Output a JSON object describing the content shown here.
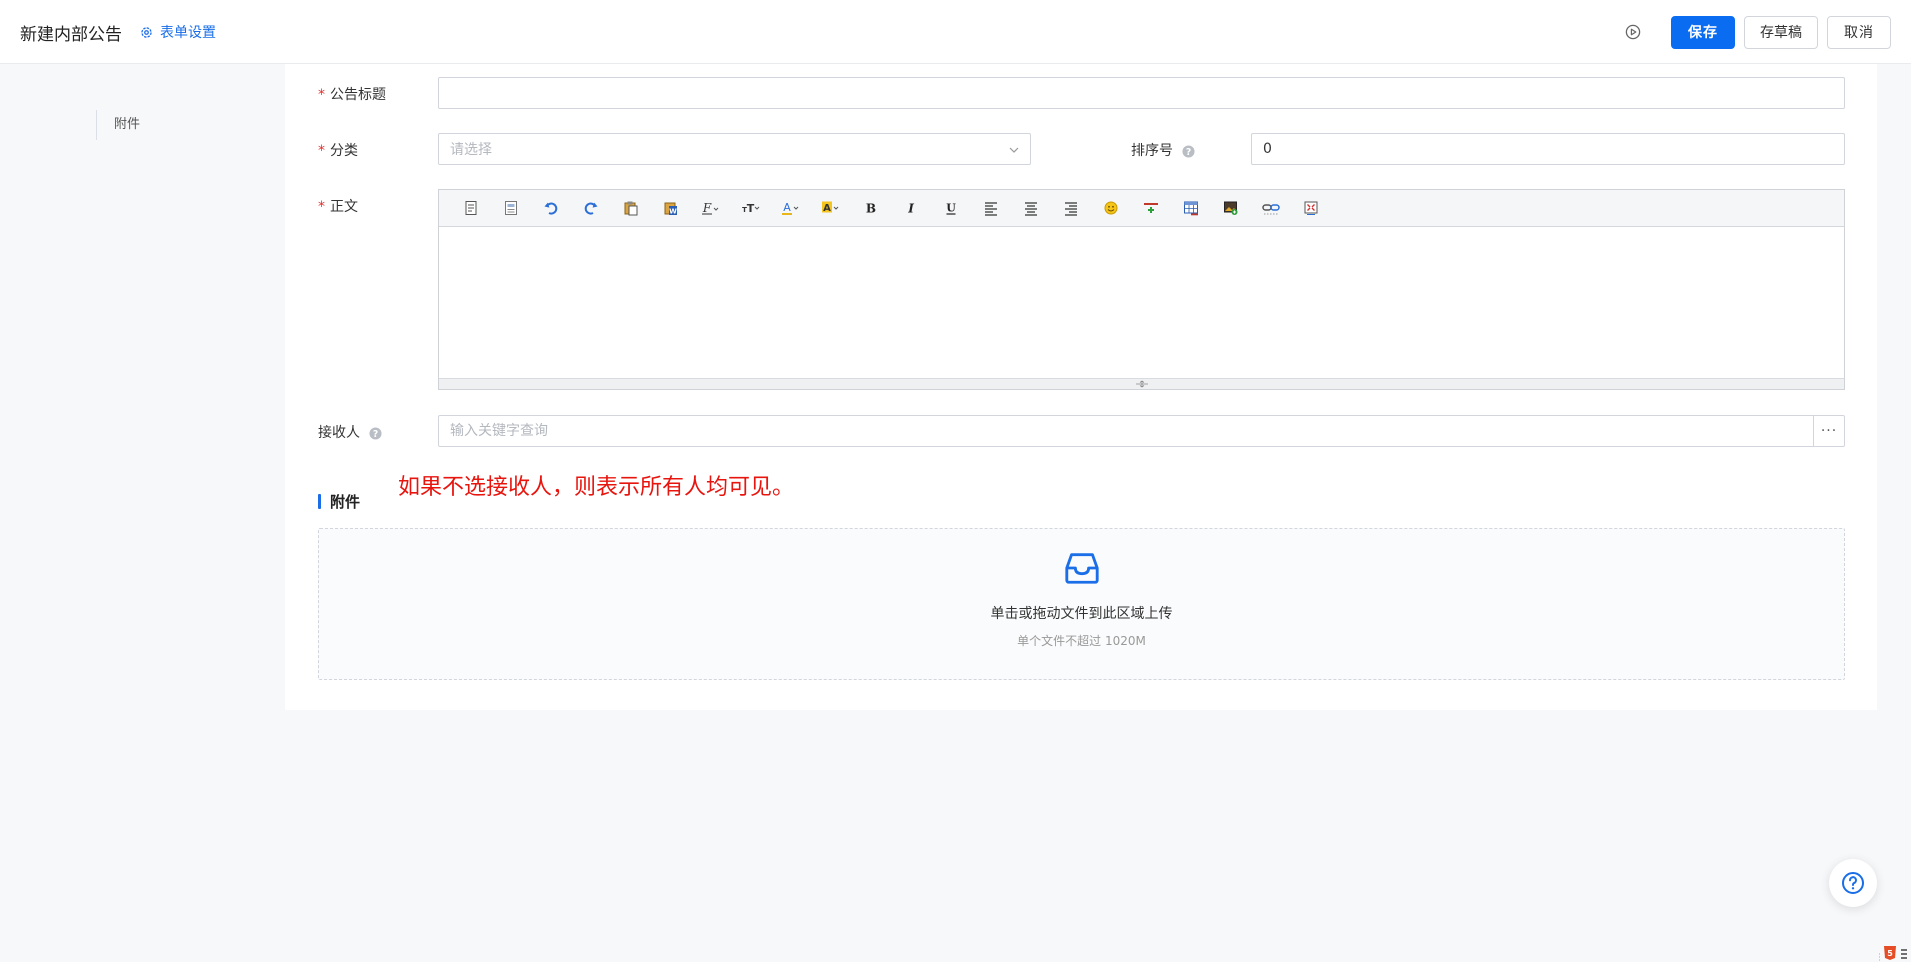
{
  "header": {
    "title": "新建内部公告",
    "form_settings": "表单设置",
    "save": "保存",
    "draft": "存草稿",
    "cancel": "取消"
  },
  "side_anchor": {
    "label": "附件"
  },
  "form": {
    "title_label": "公告标题",
    "title_value": "",
    "category_label": "分类",
    "category_placeholder": "请选择",
    "sort_label": "排序号",
    "sort_value": "0",
    "body_label": "正文",
    "receiver_label": "接收人",
    "receiver_placeholder": "输入关键字查询",
    "more": "···"
  },
  "note": "如果不选接收人，则表示所有人均可见。",
  "attachment": {
    "section_title": "附件",
    "upload_title": "单击或拖动文件到此区域上传",
    "upload_hint": "单个文件不超过 1020M"
  },
  "toolbar_icons": [
    "source-icon",
    "template-icon",
    "undo-icon",
    "redo-icon",
    "paste-icon",
    "paste-word-icon",
    "font-family-icon",
    "font-size-icon",
    "font-color-icon",
    "background-color-icon",
    "bold-icon",
    "italic-icon",
    "underline-icon",
    "align-left-icon",
    "align-center-icon",
    "align-right-icon",
    "emoticon-icon",
    "horizontal-rule-icon",
    "table-icon",
    "image-icon",
    "link-icon",
    "fullscreen-icon"
  ],
  "colors": {
    "primary": "#0a6cf0",
    "link": "#1a6ee8",
    "required": "#e5302a",
    "note": "#e8140e"
  }
}
